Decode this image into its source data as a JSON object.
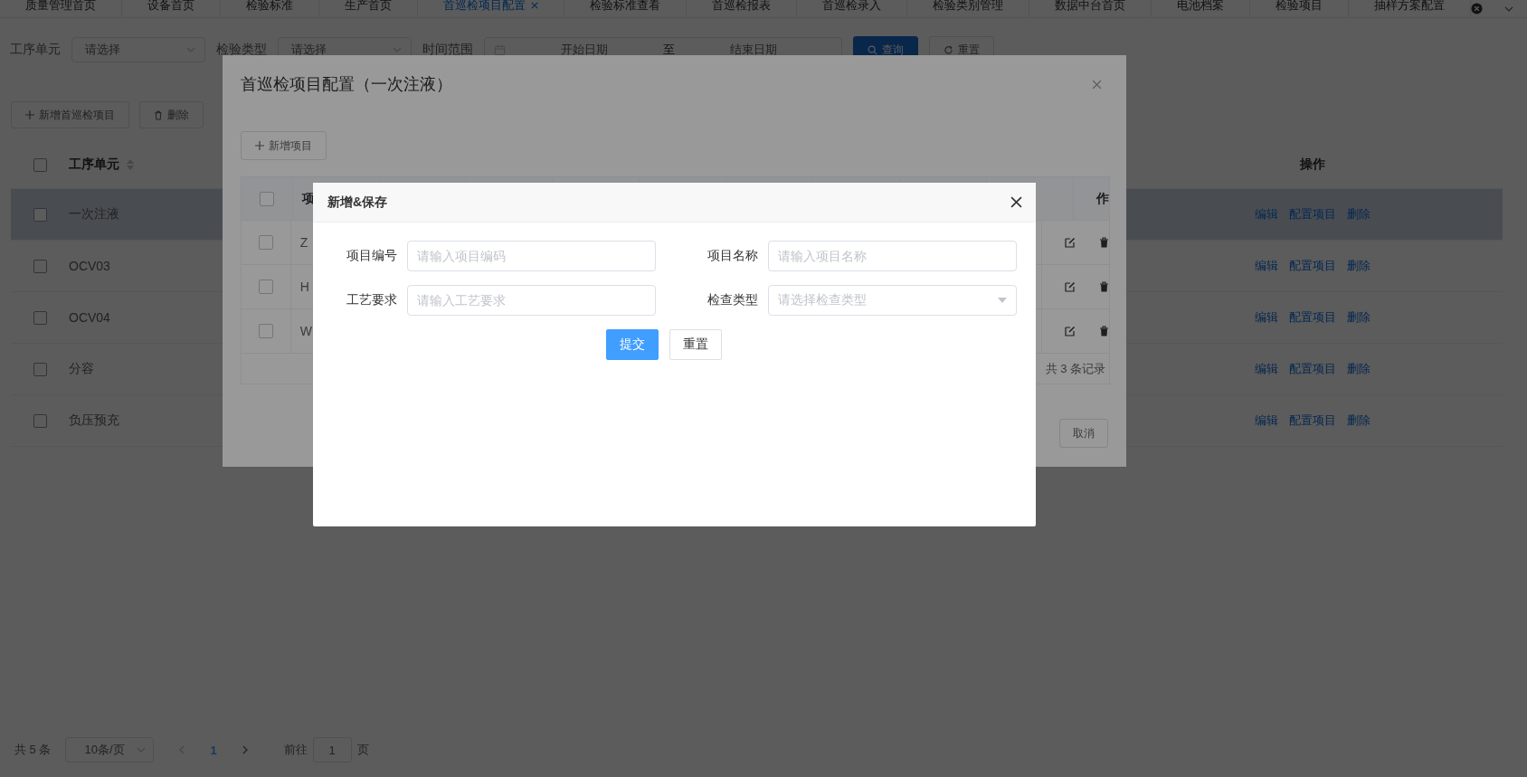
{
  "tabs": [
    {
      "label": "质量管理首页",
      "selected": false,
      "closable": false
    },
    {
      "label": "设备首页",
      "selected": false,
      "closable": false
    },
    {
      "label": "检验标准",
      "selected": false,
      "closable": false
    },
    {
      "label": "生产首页",
      "selected": false,
      "closable": false
    },
    {
      "label": "首巡检项目配置",
      "selected": true,
      "closable": true
    },
    {
      "label": "检验标准查看",
      "selected": false,
      "closable": false
    },
    {
      "label": "首巡检报表",
      "selected": false,
      "closable": false
    },
    {
      "label": "首巡检录入",
      "selected": false,
      "closable": false
    },
    {
      "label": "检验类别管理",
      "selected": false,
      "closable": false
    },
    {
      "label": "数据中台首页",
      "selected": false,
      "closable": false
    },
    {
      "label": "电池档案",
      "selected": false,
      "closable": false
    },
    {
      "label": "检验项目",
      "selected": false,
      "closable": false
    },
    {
      "label": "抽样方案配置",
      "selected": false,
      "closable": false
    }
  ],
  "filters": {
    "process_unit": {
      "label": "工序单元",
      "placeholder": "请选择"
    },
    "inspection_type": {
      "label": "检验类型",
      "placeholder": "请选择"
    },
    "time_range": {
      "label": "时间范围",
      "start_placeholder": "开始日期",
      "separator": "至",
      "end_placeholder": "结束日期"
    },
    "search_button": "查询",
    "reset_button": "重置"
  },
  "toolbar": {
    "add_button": "新增首巡检项目",
    "delete_button": "删除"
  },
  "table": {
    "all_checked": false,
    "columns": {
      "process_unit": "工序单元",
      "actions": "操作"
    },
    "rows": [
      {
        "process_unit": "一次注液",
        "selected": true,
        "checked": false,
        "actions": [
          "编辑",
          "配置项目",
          "删除"
        ]
      },
      {
        "process_unit": "OCV03",
        "selected": false,
        "checked": false,
        "actions": [
          "编辑",
          "配置项目",
          "删除"
        ]
      },
      {
        "process_unit": "OCV04",
        "selected": false,
        "checked": false,
        "actions": [
          "编辑",
          "配置项目",
          "删除"
        ]
      },
      {
        "process_unit": "分容",
        "selected": false,
        "checked": false,
        "actions": [
          "编辑",
          "配置项目",
          "删除"
        ]
      },
      {
        "process_unit": "负压预充",
        "selected": false,
        "checked": false,
        "actions": [
          "编辑",
          "配置项目",
          "删除"
        ]
      }
    ]
  },
  "pagination": {
    "total": "共 5 条",
    "page_size": "10条/页",
    "current_page": "1",
    "goto_label": "前往",
    "goto_value": "1",
    "page_suffix": "页"
  },
  "config_dialog": {
    "title": "首巡检项目配置（一次注液）",
    "add_button": "新增项目",
    "all_checked": false,
    "columns": {
      "column_1": "项",
      "actions": "作"
    },
    "rows": [
      {
        "column_1": "Z",
        "checked": false
      },
      {
        "column_1": "H",
        "checked": false
      },
      {
        "column_1": "W",
        "checked": false
      }
    ],
    "total": "共 3 条记录",
    "cancel_button": "取消"
  },
  "form_dialog": {
    "title": "新增&保存",
    "fields": [
      {
        "label": "项目编号",
        "placeholder": "请输入项目编码",
        "kind": "input"
      },
      {
        "label": "项目名称",
        "placeholder": "请输入项目名称",
        "kind": "input"
      },
      {
        "label": "工艺要求",
        "placeholder": "请输入工艺要求",
        "kind": "input"
      },
      {
        "label": "检查类型",
        "placeholder": "请选择检查类型",
        "kind": "select"
      }
    ],
    "submit_button": "提交",
    "reset_button": "重置"
  }
}
